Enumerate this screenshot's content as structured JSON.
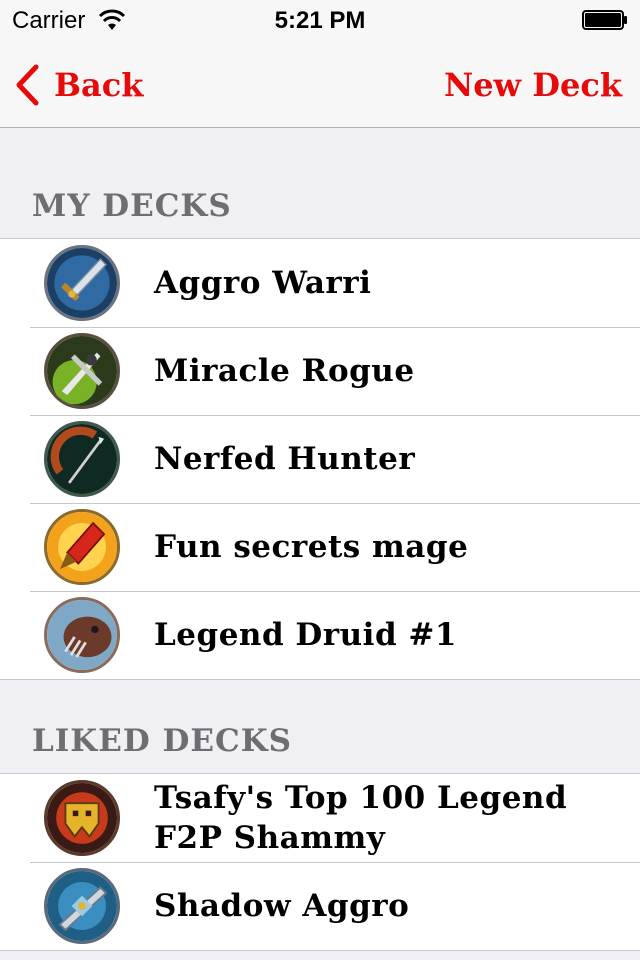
{
  "status_bar": {
    "carrier": "Carrier",
    "time": "5:21 PM",
    "icons": [
      "wifi-icon",
      "battery-icon"
    ]
  },
  "nav": {
    "back_label": "Back",
    "new_deck_label": "New Deck",
    "accent_color": "#e60a0a"
  },
  "sections": {
    "my_decks": {
      "title": "MY DECKS",
      "items": [
        {
          "label": "Aggro Warri",
          "icon": "warrior-class-icon"
        },
        {
          "label": "Miracle Rogue",
          "icon": "rogue-class-icon"
        },
        {
          "label": "Nerfed Hunter",
          "icon": "hunter-class-icon"
        },
        {
          "label": "Fun secrets mage",
          "icon": "mage-class-icon"
        },
        {
          "label": "Legend Druid #1",
          "icon": "druid-class-icon"
        }
      ]
    },
    "liked_decks": {
      "title": "LIKED DECKS",
      "items": [
        {
          "label": "Tsafy's Top 100 Legend F2P Shammy",
          "icon": "shaman-class-icon"
        },
        {
          "label": "Shadow Aggro",
          "icon": "priest-class-icon"
        }
      ]
    }
  }
}
